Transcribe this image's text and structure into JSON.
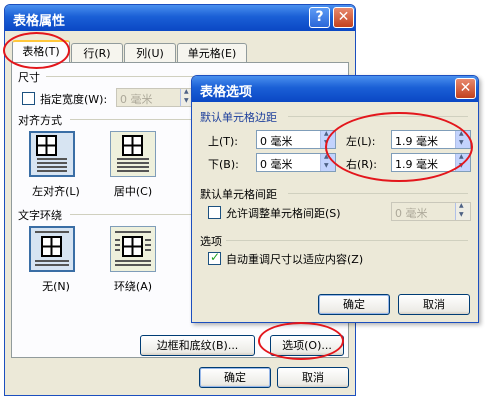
{
  "main_window": {
    "title": "表格属性",
    "tabs": [
      {
        "label": "表格(T)"
      },
      {
        "label": "行(R)"
      },
      {
        "label": "列(U)"
      },
      {
        "label": "单元格(E)"
      }
    ],
    "size_section": "尺寸",
    "preferred_width_label": "指定宽度(W):",
    "preferred_width_value": "0 毫米",
    "alignment_section": "对齐方式",
    "align_left_label": "左对齐(L)",
    "align_center_label": "居中(C)",
    "text_wrap_section": "文字环绕",
    "wrap_none_label": "无(N)",
    "wrap_around_label": "环绕(A)",
    "borders_button": "边框和底纹(B)...",
    "options_button": "选项(O)...",
    "ok_button": "确定",
    "cancel_button": "取消"
  },
  "options_dialog": {
    "title": "表格选项",
    "default_margins_section": "默认单元格边距",
    "top_label": "上(T):",
    "top_value": "0 毫米",
    "bottom_label": "下(B):",
    "bottom_value": "0 毫米",
    "left_label": "左(L):",
    "left_value": "1.9 毫米",
    "right_label": "右(R):",
    "right_value": "1.9 毫米",
    "default_spacing_section": "默认单元格间距",
    "allow_spacing_label": "允许调整单元格间距(S)",
    "spacing_value": "0 毫米",
    "options_section": "选项",
    "autoresize_label": "自动重调尺寸以适应内容(Z)",
    "autoresize_checked": true,
    "ok_button": "确定",
    "cancel_button": "取消"
  },
  "colors": {
    "annotation_red": "#e3161c",
    "xp_blue": "#0a47c4"
  }
}
